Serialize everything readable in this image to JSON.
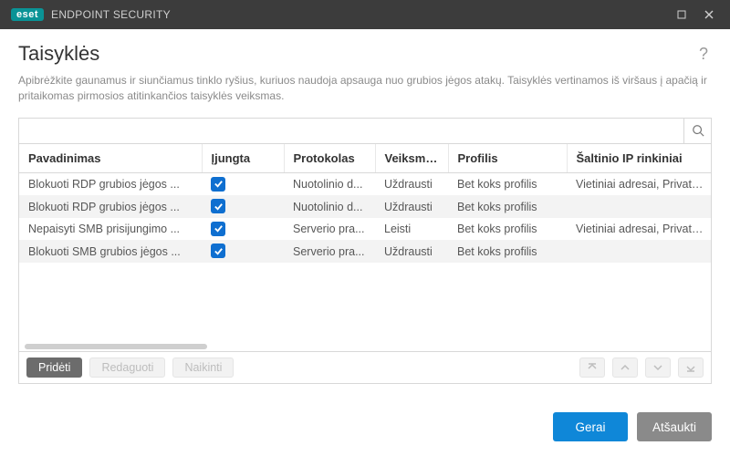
{
  "brand": {
    "badge": "eset",
    "name": "ENDPOINT SECURITY"
  },
  "page": {
    "title": "Taisyklės",
    "description": "Apibrėžkite gaunamus ir siunčiamus tinklo ryšius, kuriuos naudoja apsauga nuo grubios jėgos atakų. Taisyklės vertinamos iš viršaus į apačią ir pritaikomas pirmosios atitinkančios taisyklės veiksmas."
  },
  "search": {
    "placeholder": ""
  },
  "columns": {
    "name": "Pavadinimas",
    "enabled": "Įjungta",
    "protocol": "Protokolas",
    "action": "Veiksmas",
    "profile": "Profilis",
    "source_ip": "Šaltinio IP rinkiniai"
  },
  "rows": [
    {
      "name": "Blokuoti RDP grubios jėgos ...",
      "enabled": true,
      "protocol": "Nuotolinio d...",
      "action": "Uždrausti",
      "profile": "Bet koks profilis",
      "source_ip": "Vietiniai adresai, Privatūs adresai"
    },
    {
      "name": "Blokuoti RDP grubios jėgos ...",
      "enabled": true,
      "protocol": "Nuotolinio d...",
      "action": "Uždrausti",
      "profile": "Bet koks profilis",
      "source_ip": ""
    },
    {
      "name": "Nepaisyti SMB prisijungimo ...",
      "enabled": true,
      "protocol": "Serverio pra...",
      "action": "Leisti",
      "profile": "Bet koks profilis",
      "source_ip": "Vietiniai adresai, Privatūs adresai"
    },
    {
      "name": "Blokuoti SMB grubios jėgos ...",
      "enabled": true,
      "protocol": "Serverio pra...",
      "action": "Uždrausti",
      "profile": "Bet koks profilis",
      "source_ip": ""
    }
  ],
  "buttons": {
    "add": "Pridėti",
    "edit": "Redaguoti",
    "delete": "Naikinti",
    "ok": "Gerai",
    "cancel": "Atšaukti"
  }
}
